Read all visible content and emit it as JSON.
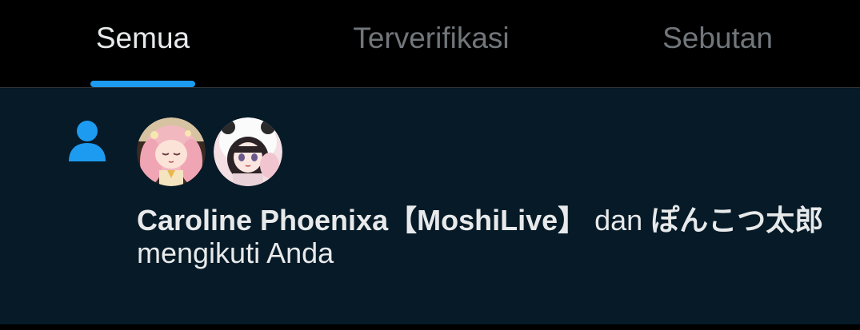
{
  "tabs": [
    {
      "label": "Semua",
      "active": true
    },
    {
      "label": "Terverifikasi",
      "active": false
    },
    {
      "label": "Sebutan",
      "active": false
    }
  ],
  "notification": {
    "icon": "person-icon",
    "avatars": [
      {
        "name": "Caroline Phoenixa【MoshiLive】",
        "icon": "avatar-pink-hair"
      },
      {
        "name": "ぽんこつ太郎",
        "icon": "avatar-panda-hood"
      }
    ],
    "user1": "Caroline Phoenixa【MoshiLive】",
    "conjunction": " dan ",
    "user2": "ぽんこつ太郎",
    "action": " mengikuti Anda"
  },
  "colors": {
    "accent": "#1d9bf0",
    "background": "#000000",
    "notification_bg": "#061a27",
    "text_primary": "#e7e9ea",
    "text_secondary": "#71767b"
  }
}
